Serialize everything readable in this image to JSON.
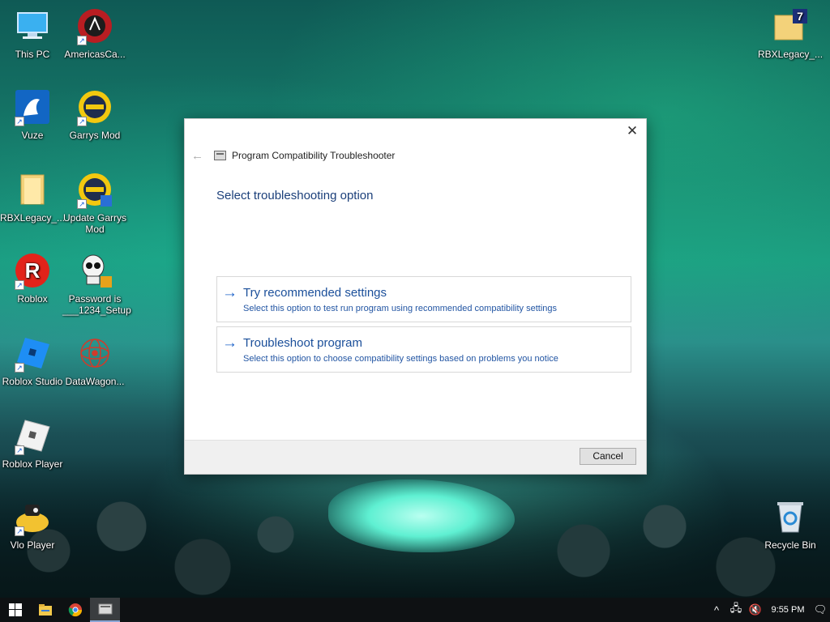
{
  "desktop": {
    "icons": [
      {
        "label": "This PC",
        "icon": "computer-icon"
      },
      {
        "label": "AmericasCa...",
        "icon": "casino-chip-icon"
      },
      {
        "label": "RBXLegacy_...",
        "icon": "folder-icon"
      },
      {
        "label": "Vuze",
        "icon": "vuze-frog-icon"
      },
      {
        "label": "Garrys Mod",
        "icon": "garrys-mod-icon"
      },
      {
        "label": "RBXLegacy_...",
        "icon": "folder-icon"
      },
      {
        "label": "Update Garrys Mod",
        "icon": "garrys-mod-icon"
      },
      {
        "label": "Roblox",
        "icon": "roblox-icon"
      },
      {
        "label": "Password is ___1234_Setup",
        "icon": "skull-icon"
      },
      {
        "label": "Roblox Studio",
        "icon": "roblox-studio-icon"
      },
      {
        "label": "DataWagon...",
        "icon": "datawagon-icon"
      },
      {
        "label": "Roblox Player",
        "icon": "roblox-player-icon"
      },
      {
        "label": "Vlo Player",
        "icon": "vlo-player-icon"
      },
      {
        "label": "Recycle Bin",
        "icon": "recycle-bin-icon"
      }
    ]
  },
  "dialog": {
    "title": "Program Compatibility Troubleshooter",
    "heading": "Select troubleshooting option",
    "options": [
      {
        "title": "Try recommended settings",
        "description": "Select this option to test run program using recommended compatibility settings"
      },
      {
        "title": "Troubleshoot program",
        "description": "Select this option to choose compatibility settings based on problems you notice"
      }
    ],
    "cancel_label": "Cancel",
    "arrow_glyph": "→",
    "close_glyph": "✕",
    "back_glyph": "←"
  },
  "taskbar": {
    "clock": "9:55 PM",
    "items": [
      "windows-start-icon",
      "file-explorer-icon",
      "chrome-icon",
      "troubleshooter-taskbar-icon"
    ]
  },
  "colors": {
    "accent": "#1e63c9",
    "heading": "#1b3f7a",
    "taskbar": "#0e1113"
  }
}
